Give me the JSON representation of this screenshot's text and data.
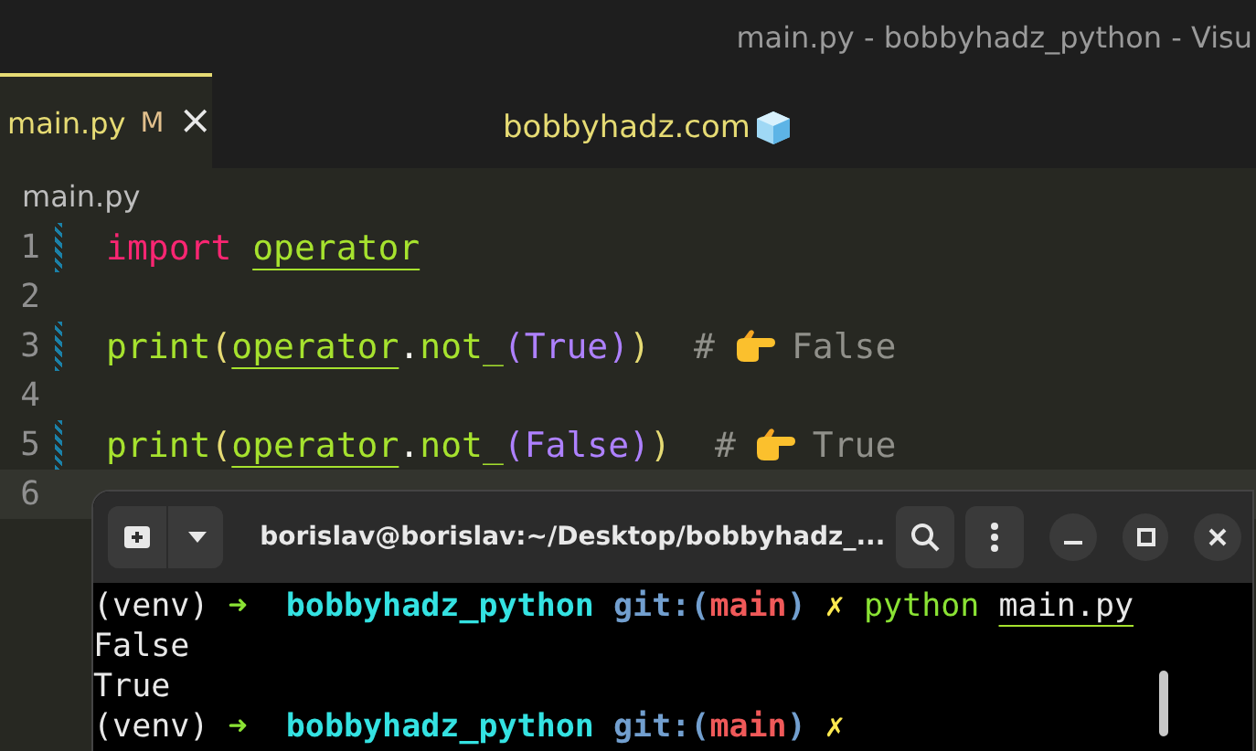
{
  "window": {
    "title": "main.py - bobbyhadz_python - Visu"
  },
  "tabs": [
    {
      "label": "main.py",
      "badge": "M",
      "close": "×",
      "selected": true
    }
  ],
  "watermark_text": "bobbyhadz.com",
  "breadcrumb": "main.py",
  "code_lines": [
    {
      "number": "1",
      "modified": true,
      "current": false,
      "tokens": [
        {
          "kind": "keyword",
          "text": "import "
        },
        {
          "kind": "module",
          "text": "operator"
        }
      ]
    },
    {
      "number": "2",
      "modified": false,
      "current": false
    },
    {
      "number": "3",
      "modified": true,
      "current": false,
      "tokens": [
        {
          "kind": "func",
          "text": "print"
        },
        {
          "kind": "paren",
          "text": "("
        },
        {
          "kind": "module",
          "text": "operator"
        },
        {
          "kind": "plain",
          "text": "."
        },
        {
          "kind": "func",
          "text": "not_"
        },
        {
          "kind": "paren2",
          "text": "("
        },
        {
          "kind": "const",
          "text": "True"
        },
        {
          "kind": "paren2",
          "text": ")"
        },
        {
          "kind": "paren",
          "text": ")"
        }
      ],
      "comment_mark": "#",
      "comment": "False"
    },
    {
      "number": "4",
      "modified": false,
      "current": false
    },
    {
      "number": "5",
      "modified": true,
      "current": false,
      "tokens": [
        {
          "kind": "func",
          "text": "print"
        },
        {
          "kind": "paren",
          "text": "("
        },
        {
          "kind": "module",
          "text": "operator"
        },
        {
          "kind": "plain",
          "text": "."
        },
        {
          "kind": "func",
          "text": "not_"
        },
        {
          "kind": "paren2",
          "text": "("
        },
        {
          "kind": "const",
          "text": "False"
        },
        {
          "kind": "paren2",
          "text": ")"
        },
        {
          "kind": "paren",
          "text": ")"
        }
      ],
      "comment_mark": "#",
      "comment": "True"
    },
    {
      "number": "6",
      "modified": false,
      "current": true
    }
  ],
  "terminal": {
    "title": "borislav@borislav:~/Desktop/bobbyhadz_...",
    "lines": [
      [
        {
          "kind": "plain",
          "text": "(venv) "
        },
        {
          "kind": "arrow",
          "text": "➜  "
        },
        {
          "kind": "dir",
          "text": "bobbyhadz_python "
        },
        {
          "kind": "git",
          "text": "git:("
        },
        {
          "kind": "branch",
          "text": "main"
        },
        {
          "kind": "git",
          "text": ") "
        },
        {
          "kind": "dirty",
          "text": "✗ "
        },
        {
          "kind": "cmd",
          "text": "python "
        },
        {
          "kind": "file",
          "text": "main.py"
        }
      ],
      [
        {
          "kind": "plain",
          "text": "False"
        }
      ],
      [
        {
          "kind": "plain",
          "text": "True"
        }
      ],
      [
        {
          "kind": "plain",
          "text": "(venv) "
        },
        {
          "kind": "arrow",
          "text": "➜  "
        },
        {
          "kind": "dir",
          "text": "bobbyhadz_python "
        },
        {
          "kind": "git",
          "text": "git:("
        },
        {
          "kind": "branch",
          "text": "main"
        },
        {
          "kind": "git",
          "text": ") "
        },
        {
          "kind": "dirty",
          "text": "✗"
        }
      ]
    ]
  }
}
